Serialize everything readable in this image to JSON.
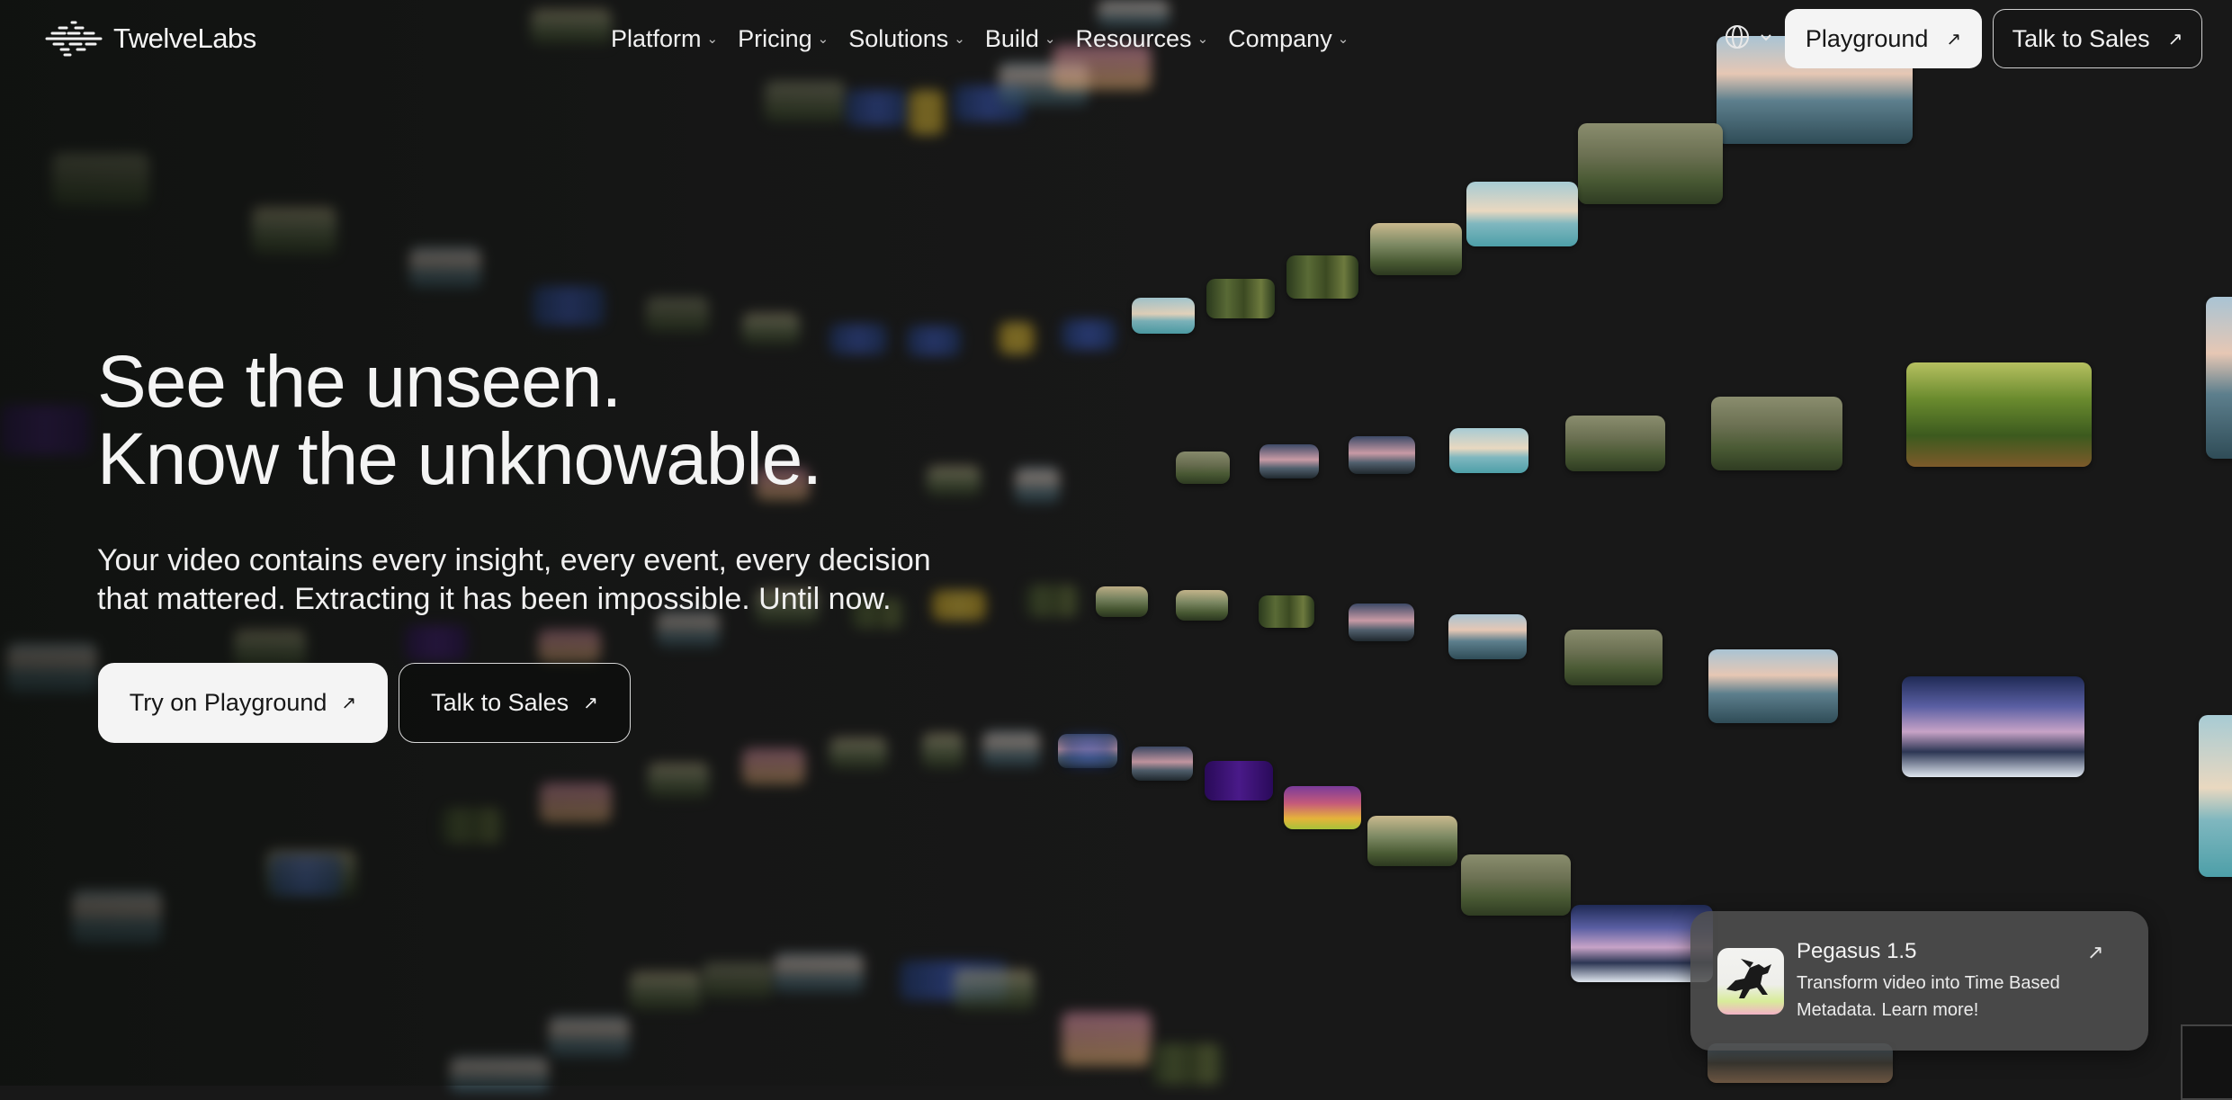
{
  "brand": {
    "name": "TwelveLabs",
    "logo_icon": "twelvelabs-logo-icon"
  },
  "nav": {
    "items": [
      {
        "label": "Platform"
      },
      {
        "label": "Pricing"
      },
      {
        "label": "Solutions"
      },
      {
        "label": "Build"
      },
      {
        "label": "Resources"
      },
      {
        "label": "Company"
      }
    ],
    "language_icon": "globe-icon",
    "playground_label": "Playground",
    "sales_label": "Talk to Sales"
  },
  "hero": {
    "title_line1": "See the unseen.",
    "title_line2": "Know the unknowable.",
    "subtitle_line1": "Your video contains every insight, every event, every decision",
    "subtitle_line2": "that mattered. Extracting it has been impossible. Until now.",
    "cta_primary": "Try on Playground",
    "cta_secondary": "Talk to Sales"
  },
  "promo": {
    "title": "Pegasus 1.5",
    "desc_line1": "Transform video into Time Based",
    "desc_line2": "Metadata. Learn more!",
    "icon": "pegasus-icon"
  },
  "colors": {
    "background": "#181818",
    "button_light": "#f4f4f4",
    "promo_card": "#4e4e4e"
  }
}
